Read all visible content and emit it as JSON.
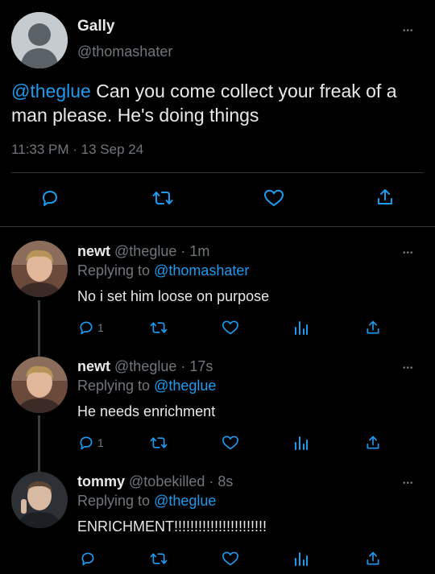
{
  "main_tweet": {
    "name": "Gally",
    "handle": "@thomashater",
    "mention": "@theglue",
    "text": " Can you come collect your freak of a man please. He's doing things",
    "time": "11:33 PM",
    "sep": "·",
    "date": "13 Sep 24",
    "icons": [
      "reply-icon",
      "retweet-icon",
      "like-icon",
      "share-icon"
    ]
  },
  "replies": [
    {
      "name": "newt",
      "handle": "@theglue",
      "sep": "·",
      "time": "1m",
      "replying_prefix": "Replying to",
      "replying_to": "@thomashater",
      "text": "No i set him loose on purpose",
      "reply_count": "1"
    },
    {
      "name": "newt",
      "handle": "@theglue",
      "sep": "·",
      "time": "17s",
      "replying_prefix": "Replying to",
      "replying_to": "@theglue",
      "text": "He needs enrichment",
      "reply_count": "1"
    },
    {
      "name": "tommy",
      "handle": "@tobekilled",
      "sep": "·",
      "time": "8s",
      "replying_prefix": "Replying to",
      "replying_to": "@theglue",
      "text": "ENRICHMENT!!!!!!!!!!!!!!!!!!!!!!!",
      "reply_count": ""
    }
  ],
  "more_glyph": "•••",
  "colors": {
    "background": "#000000",
    "accent": "#1d9bf0",
    "muted": "#71767b",
    "text": "#e7e9ea"
  }
}
